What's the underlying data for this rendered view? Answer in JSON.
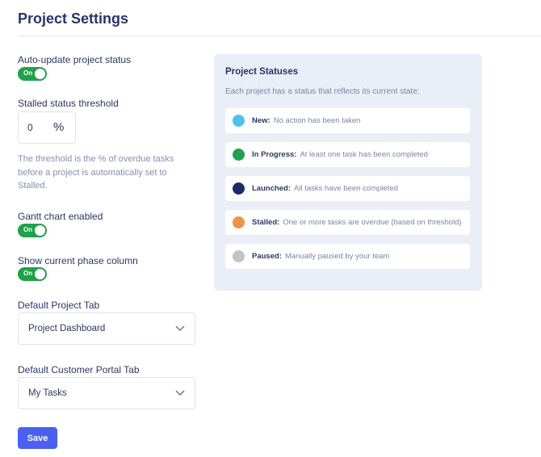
{
  "page": {
    "title": "Project Settings"
  },
  "settings": {
    "auto_update": {
      "label": "Auto-update project status",
      "toggle": "On"
    },
    "stalled": {
      "label": "Stalled status threshold",
      "value": "0",
      "unit": "%",
      "help": "The threshold is the % of overdue tasks before a project is automatically set to Stalled."
    },
    "gantt": {
      "label": "Gantt chart enabled",
      "toggle": "On"
    },
    "phase_column": {
      "label": "Show current phase column",
      "toggle": "On"
    },
    "default_tab": {
      "label": "Default Project Tab",
      "value": "Project Dashboard"
    },
    "portal_tab": {
      "label": "Default Customer Portal Tab",
      "value": "My Tasks"
    },
    "save_label": "Save"
  },
  "statuses_panel": {
    "title": "Project Statuses",
    "description": "Each project has a status that reflects its current state:",
    "items": [
      {
        "name": "New:",
        "desc": "No action has been taken",
        "color": "#4fc3ea"
      },
      {
        "name": "In Progress:",
        "desc": "At least one task has been completed",
        "color": "#1fa24a"
      },
      {
        "name": "Launched:",
        "desc": "All tasks have been completed",
        "color": "#1f2a6b"
      },
      {
        "name": "Stalled:",
        "desc": "One or more tasks are overdue (based on threshold)",
        "color": "#f0924a"
      },
      {
        "name": "Paused:",
        "desc": "Manually paused by your team",
        "color": "#c4c4c4"
      }
    ]
  },
  "colors": {
    "accent": "#4a60f2",
    "toggle_on": "#1fa24a",
    "panel_bg": "#eaeef7"
  }
}
